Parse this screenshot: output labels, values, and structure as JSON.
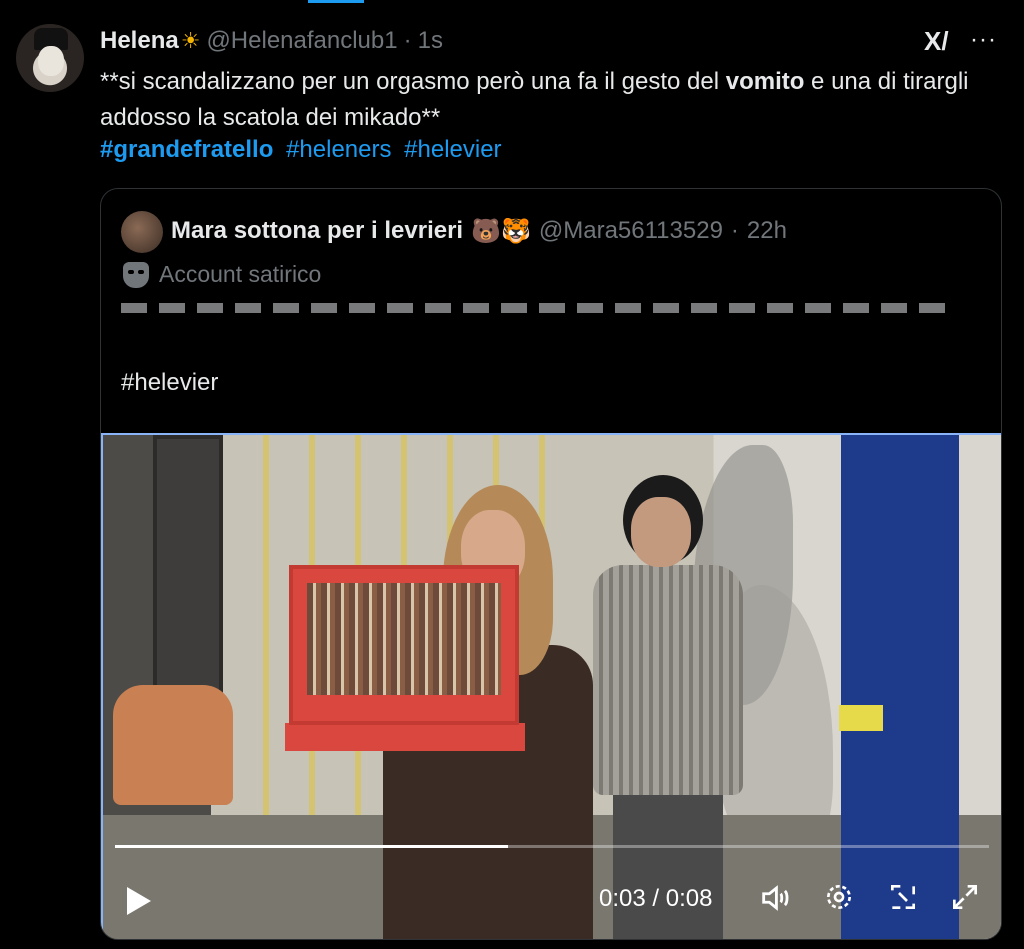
{
  "tweet": {
    "author_name": "Helena",
    "author_emoji": "☀",
    "handle": "@Helenafanclub1",
    "separator": "·",
    "time": "1s",
    "text_part1": "**si scandalizzano per un orgasmo però una fa il gesto del ",
    "text_bold": "vomito",
    "text_part2": " e una di tirargli addosso la scatola dei mikado**",
    "hashtags": [
      "#grandefratello",
      "#heleners",
      "#helevier"
    ]
  },
  "actions": {
    "grok_icon": "grok-icon",
    "more_icon": "more-icon",
    "grok_glyph": "X/",
    "more_glyph": "···"
  },
  "quote": {
    "author_name": "Mara sottona per i levrieri",
    "author_emojis": "🐻🐯",
    "handle": "@Mara56113529",
    "separator": "·",
    "time": "22h",
    "label": "Account satirico",
    "hashtag": "#helevier"
  },
  "video": {
    "current_time": "0:03",
    "duration": "0:08",
    "time_sep": " / ",
    "progress": 0.45,
    "icons": [
      "play-icon",
      "volume-icon",
      "settings-gear-icon",
      "picture-in-picture-icon",
      "fullscreen-icon"
    ]
  },
  "colors": {
    "background": "#000000",
    "link": "#1d9bf0",
    "muted": "#71767b",
    "text": "#e7e9ea"
  }
}
